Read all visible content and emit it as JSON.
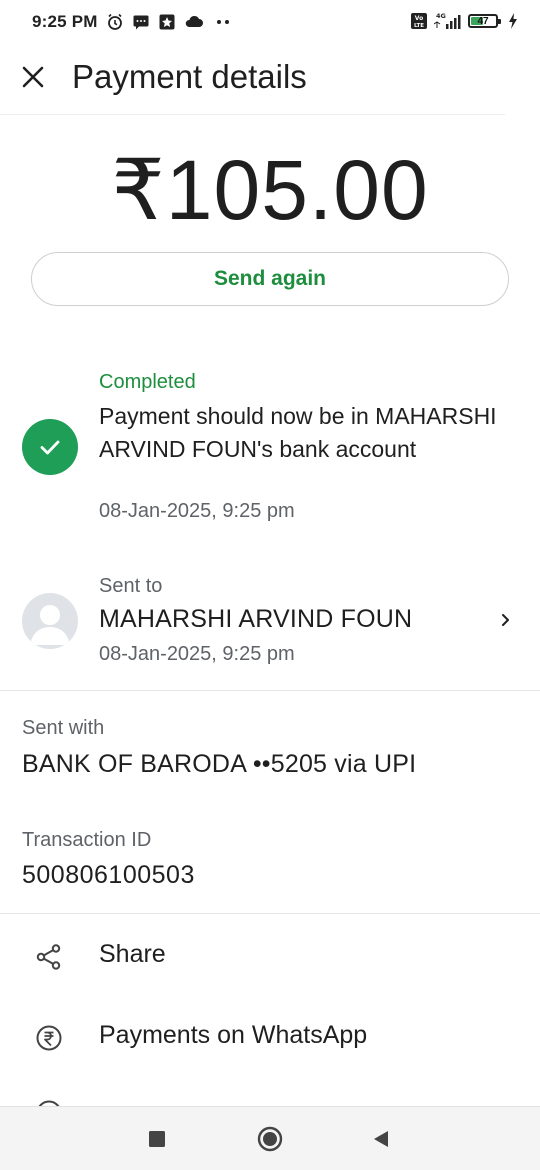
{
  "status_bar": {
    "time": "9:25 PM",
    "icons_left": [
      "alarm-icon",
      "message-icon",
      "notification-icon",
      "cloud-icon",
      "more-dots-icon"
    ],
    "network_label": "4G",
    "volte_label": "Vo LTE",
    "battery_percent": "47"
  },
  "header": {
    "title": "Payment details",
    "close_icon": "close-icon"
  },
  "payment": {
    "amount": "₹105.00",
    "send_again_label": "Send again"
  },
  "status": {
    "label": "Completed",
    "message": "Payment should now be in MAHARSHI ARVIND FOUN's bank account",
    "timestamp": "08-Jan-2025, 9:25 pm",
    "color": "#1e9e57"
  },
  "recipient": {
    "label": "Sent to",
    "name": "MAHARSHI ARVIND FOUN",
    "timestamp": "08-Jan-2025, 9:25 pm"
  },
  "sent_with": {
    "label": "Sent with",
    "value": "BANK OF BARODA ••5205 via UPI"
  },
  "transaction": {
    "label": "Transaction ID",
    "value": "500806100503"
  },
  "actions": [
    {
      "label": "Share",
      "icon": "share-icon"
    },
    {
      "label": "Payments on WhatsApp",
      "icon": "rupee-circle-icon"
    }
  ],
  "nav": [
    "recents-square-icon",
    "home-circle-icon",
    "back-triangle-icon"
  ],
  "colors": {
    "accent_green": "#1e8e3e",
    "secondary_text": "#5f6368"
  }
}
